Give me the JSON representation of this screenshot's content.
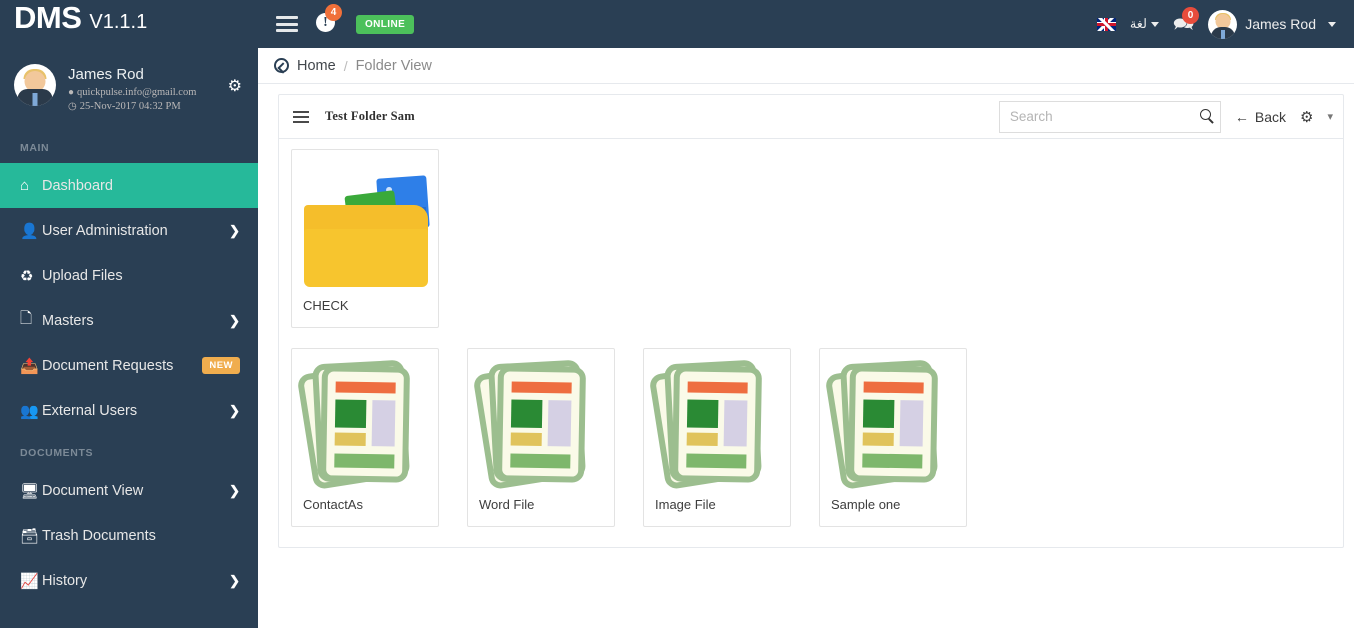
{
  "header": {
    "brand_name": "DMS",
    "version": "V1.1.1",
    "menu_toggle_icon": "hamburger-icon",
    "alert_icon": "exclamation-circle-icon",
    "alert_count": "4",
    "status_label": "ONLINE",
    "flag_icon": "uk-flag-icon",
    "language_label": "لغة",
    "chat_icon": "chat-bubbles-icon",
    "chat_count": "0",
    "user_name": "James Rod"
  },
  "sidebar": {
    "profile": {
      "name": "James Rod",
      "email": "quickpulse.info@gmail.com",
      "datetime": "25-Nov-2017 04:32 PM",
      "email_icon": "location-pin-icon",
      "time_icon": "clock-icon",
      "settings_icon": "gear-icon"
    },
    "sections": [
      {
        "title": "MAIN",
        "items": [
          {
            "label": "Dashboard",
            "icon": "home-icon",
            "active": true,
            "arrow": false,
            "badge": ""
          },
          {
            "label": "User Administration",
            "icon": "user-icon",
            "active": false,
            "arrow": true,
            "badge": ""
          },
          {
            "label": "Upload Files",
            "icon": "recycle-icon",
            "active": false,
            "arrow": false,
            "badge": ""
          },
          {
            "label": "Masters",
            "icon": "file-icon",
            "active": false,
            "arrow": true,
            "badge": ""
          },
          {
            "label": "Document Requests",
            "icon": "export-icon",
            "active": false,
            "arrow": false,
            "badge": "NEW"
          },
          {
            "label": "External Users",
            "icon": "user-shared-icon",
            "active": false,
            "arrow": true,
            "badge": ""
          }
        ]
      },
      {
        "title": "DOCUMENTS",
        "items": [
          {
            "label": "Document View",
            "icon": "monitor-icon",
            "active": false,
            "arrow": true,
            "badge": ""
          },
          {
            "label": "Trash Documents",
            "icon": "database-icon",
            "active": false,
            "arrow": false,
            "badge": ""
          },
          {
            "label": "History",
            "icon": "chart-area-icon",
            "active": false,
            "arrow": true,
            "badge": ""
          }
        ]
      }
    ]
  },
  "breadcrumb": {
    "back_icon": "circle-arrow-left-icon",
    "home": "Home",
    "separator": "/",
    "current": "Folder View"
  },
  "panel": {
    "grip_icon": "grip-lines-icon",
    "title": "Test Folder Sam",
    "search_placeholder": "Search",
    "search_value": "",
    "search_icon": "search-icon",
    "back_label": "Back",
    "back_icon": "arrow-left-icon",
    "settings_icon": "gear-icon",
    "dropdown_icon": "chevron-down-icon",
    "folders": [
      {
        "name": "CHECK",
        "type": "folder"
      }
    ],
    "files": [
      {
        "name": "ContactAs",
        "type": "document"
      },
      {
        "name": "Word File",
        "type": "document"
      },
      {
        "name": "Image File",
        "type": "document"
      },
      {
        "name": "Sample one",
        "type": "document"
      }
    ]
  },
  "colors": {
    "header_bg": "#2A3F54",
    "sidebar_bg": "#2A3F54",
    "accent_active": "#26B99A",
    "badge_new": "#F0AD4E",
    "badge_alert": "#F0703A",
    "online": "#4CC05B",
    "folder_yellow": "#F7C52E"
  }
}
